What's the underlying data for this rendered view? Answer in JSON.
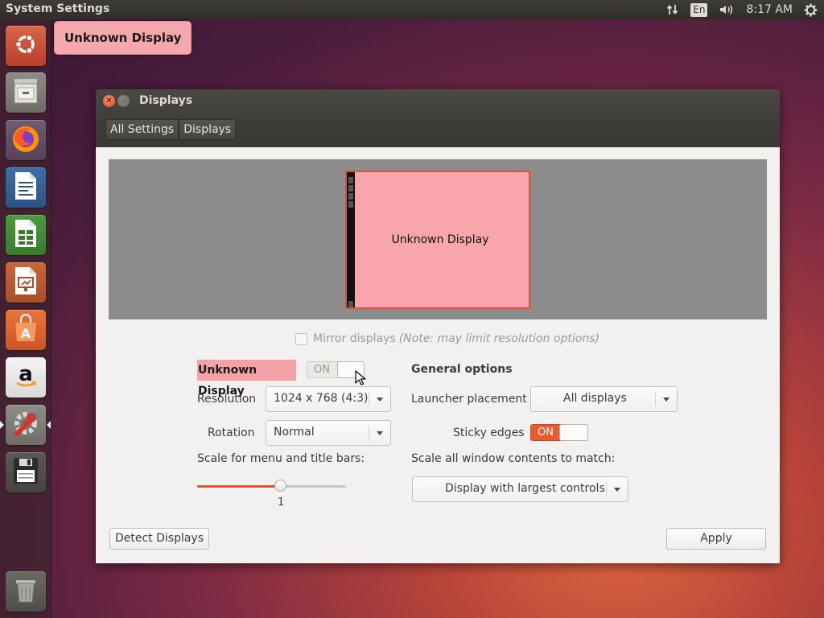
{
  "top_panel": {
    "app_title": "System Settings",
    "tray": {
      "network_icon": "network-arrows-icon",
      "keyboard_layout": "En",
      "volume_icon": "volume-icon",
      "clock": "8:17 AM",
      "settings_icon": "gear-icon"
    }
  },
  "launcher": {
    "items": [
      {
        "name": "ubuntu-dash",
        "icon": "ubuntu-logo-icon"
      },
      {
        "name": "files",
        "icon": "file-cabinet-icon"
      },
      {
        "name": "firefox",
        "icon": "firefox-icon"
      },
      {
        "name": "libreoffice-writer",
        "icon": "writer-document-icon"
      },
      {
        "name": "libreoffice-calc",
        "icon": "calc-spreadsheet-icon"
      },
      {
        "name": "libreoffice-impress",
        "icon": "impress-presentation-icon"
      },
      {
        "name": "ubuntu-software",
        "icon": "software-bag-icon"
      },
      {
        "name": "amazon",
        "icon": "amazon-icon"
      },
      {
        "name": "system-settings",
        "icon": "settings-wrench-icon",
        "active": true
      },
      {
        "name": "save-drive",
        "icon": "floppy-disk-icon"
      },
      {
        "name": "trash",
        "icon": "trash-icon"
      }
    ],
    "tooltip": "Unknown Display"
  },
  "window": {
    "title": "Displays",
    "breadcrumbs": [
      "All Settings",
      "Displays"
    ],
    "arrangement": {
      "monitor_label": "Unknown Display",
      "monitor_color": "#f8a6ab",
      "border_color": "#d7563a"
    },
    "mirror": {
      "label": "Mirror displays",
      "note": "(Note: may limit resolution options)",
      "checked": false
    },
    "display_settings": {
      "display_name": "Unknown Display",
      "power_switch": "ON",
      "resolution_label": "Resolution",
      "resolution_value": "1024 x 768 (4:3)",
      "rotation_label": "Rotation",
      "rotation_value": "Normal",
      "scale_label": "Scale for menu and title bars:",
      "scale_value": "1"
    },
    "general_options": {
      "heading": "General options",
      "launcher_placement_label": "Launcher placement",
      "launcher_placement_value": "All displays",
      "sticky_edges_label": "Sticky edges",
      "sticky_edges_switch": "ON",
      "scale_all_label": "Scale all window contents to match:",
      "scale_all_value": "Display with largest controls"
    },
    "buttons": {
      "detect": "Detect Displays",
      "apply": "Apply"
    }
  },
  "colors": {
    "accent": "#e85a2f",
    "highlight_pink": "#f4a2a7"
  }
}
